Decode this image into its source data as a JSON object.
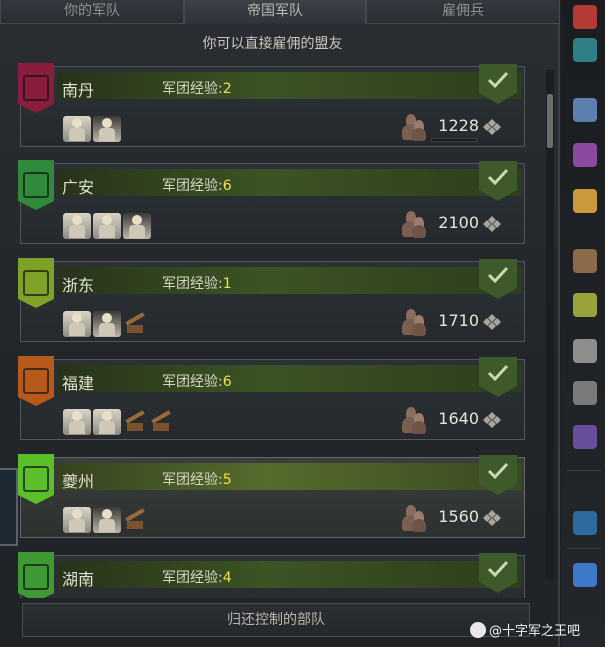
{
  "tabs": [
    {
      "label": "你的军队",
      "active": false
    },
    {
      "label": "帝国军队",
      "active": true
    },
    {
      "label": "雇佣兵",
      "active": false
    }
  ],
  "subtitle": "你可以直接雇佣的盟友",
  "xp_label": "军团经验:",
  "armies": [
    {
      "name": "南丹",
      "xp": "2",
      "count": "1228",
      "banner_color": "#8a1d3d",
      "units": [
        "u",
        "u-alt"
      ],
      "has_progress": true
    },
    {
      "name": "广安",
      "xp": "6",
      "count": "2100",
      "banner_color": "#2f8a3c",
      "units": [
        "u",
        "u",
        "u-alt"
      ],
      "has_progress": false
    },
    {
      "name": "浙东",
      "xp": "1",
      "count": "1710",
      "banner_color": "#7ea127",
      "units": [
        "u",
        "u-alt",
        "siege"
      ],
      "has_progress": false
    },
    {
      "name": "福建",
      "xp": "6",
      "count": "1640",
      "banner_color": "#b55a1a",
      "units": [
        "u",
        "u",
        "siege",
        "siege"
      ],
      "has_progress": false
    },
    {
      "name": "夔州",
      "xp": "5",
      "count": "1560",
      "banner_color": "#5bbf2a",
      "units": [
        "u",
        "u-alt",
        "siege"
      ],
      "has_progress": false
    },
    {
      "name": "湖南",
      "xp": "4",
      "count": "",
      "banner_color": "#3d9a35",
      "units": [],
      "has_progress": false
    }
  ],
  "return_button": "归还控制的部队",
  "watermark": "@十字军之王吧",
  "sidebar_icons": [
    "crossed-swords-icon",
    "banner-icon",
    "people-icon",
    "scroll-icon",
    "lion-icon",
    "quill-icon",
    "chalice-icon",
    "tower-icon",
    "alert-bag-icon",
    "abacus-icon",
    "triangle-emblem-icon",
    "eagle-emblem-icon"
  ]
}
